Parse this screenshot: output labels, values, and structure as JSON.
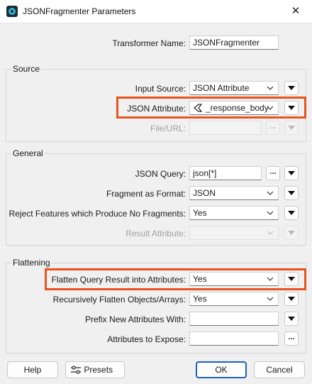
{
  "window": {
    "title": "JSONFragmenter Parameters",
    "close_glyph": "✕"
  },
  "transformer": {
    "label": "Transformer Name:",
    "value": "JSONFragmenter"
  },
  "source": {
    "title": "Source",
    "input_source": {
      "label": "Input Source:",
      "value": "JSON Attribute"
    },
    "json_attribute": {
      "label": "JSON Attribute:",
      "value": "_response_body"
    },
    "file_url": {
      "label": "File/URL:",
      "value": "",
      "button": "..."
    }
  },
  "general": {
    "title": "General",
    "json_query": {
      "label": "JSON Query:",
      "value": "json[*]",
      "button": "..."
    },
    "fragment_format": {
      "label": "Fragment as Format:",
      "value": "JSON"
    },
    "reject_features": {
      "label": "Reject Features which Produce No Fragments:",
      "value": "Yes"
    },
    "result_attribute": {
      "label": "Result Attribute:",
      "value": ""
    }
  },
  "flattening": {
    "title": "Flattening",
    "flatten_query": {
      "label": "Flatten Query Result into Attributes:",
      "value": "Yes"
    },
    "recursively_flatten": {
      "label": "Recursively Flatten Objects/Arrays:",
      "value": "Yes"
    },
    "prefix": {
      "label": "Prefix New Attributes With:",
      "value": ""
    },
    "expose": {
      "label": "Attributes to Expose:",
      "value": "",
      "button": "..."
    }
  },
  "footer": {
    "help": "Help",
    "presets": "Presets",
    "ok": "OK",
    "cancel": "Cancel"
  },
  "colors": {
    "highlight": "#e8541e",
    "primary_border": "#1e63b8"
  },
  "icons": [
    "app-icon",
    "close-icon",
    "chevron-down-icon",
    "json-attribute-icon",
    "presets-icon",
    "triangle-down-icon"
  ]
}
